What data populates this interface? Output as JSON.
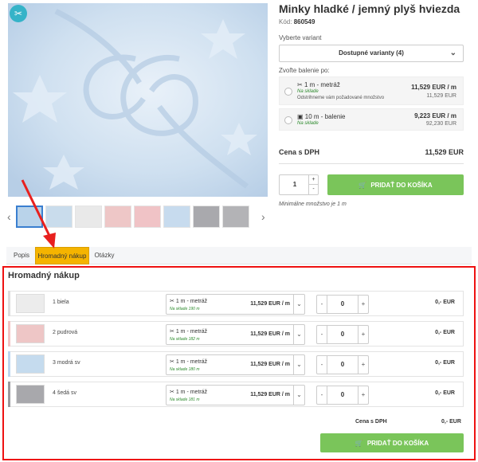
{
  "product": {
    "title": "Minky hladké / jemný plyš hviezda",
    "code_label": "Kód:",
    "code_value": "860549",
    "variant_label": "Vyberte variant",
    "variant_value": "Dostupné varianty (4)",
    "pack_label": "Zvoľte balenie po:",
    "packs": [
      {
        "name": "1 m - metráž",
        "stock": "Na sklade",
        "note": "Odstrihneme vám požadované množstvo",
        "price": "11,529 EUR / m",
        "price2": "11,529 EUR"
      },
      {
        "name": "10 m - balenie",
        "stock": "Na sklade",
        "price": "9,223 EUR / m",
        "price2": "92,230 EUR"
      }
    ],
    "cena_label": "Cena s DPH",
    "cena_value": "11,529 EUR",
    "qty": "1",
    "add_to_cart": "PRIDAŤ DO KOŠÍKA",
    "min_note": "Minimálne množstvo je 1 m"
  },
  "thumbnails": {
    "colors": [
      "#b9d3ea",
      "#c9dcec",
      "#e9e9e9",
      "#eec7c7",
      "#f0c3c6",
      "#c7dbee",
      "#a9a9ad",
      "#b3b3b6",
      "#d07a4a"
    ]
  },
  "tabs": [
    {
      "label": "Popis"
    },
    {
      "label": "Hromadný nákup"
    },
    {
      "label": "Otázky"
    }
  ],
  "bulk": {
    "title": "Hromadný nákup",
    "rows": [
      {
        "name": "1 biela",
        "swatch": "#ececec",
        "bar": "#dddddd",
        "option": "1 m - metráž",
        "stock": "Na sklade 190 m",
        "price": "11,529 EUR / m",
        "qty": "0",
        "total": "0,- EUR"
      },
      {
        "name": "2 pudrová",
        "swatch": "#eec6c6",
        "bar": "#f2c3c3",
        "option": "1 m - metráž",
        "stock": "Na sklade 182 m",
        "price": "11,529 EUR / m",
        "qty": "0",
        "total": "0,- EUR"
      },
      {
        "name": "3 modrá sv",
        "swatch": "#c5dbee",
        "bar": "#bcd5ef",
        "option": "1 m - metráž",
        "stock": "Na sklade 180 m",
        "price": "11,529 EUR / m",
        "qty": "0",
        "total": "0,- EUR"
      },
      {
        "name": "4 šedá sv",
        "swatch": "#a8a8ac",
        "bar": "#9a9a9e",
        "option": "1 m - metráž",
        "stock": "Na sklade 181 m",
        "price": "11,529 EUR / m",
        "qty": "0",
        "total": "0,- EUR"
      }
    ],
    "cena_label": "Cena s DPH",
    "cena_value": "0,- EUR",
    "add_to_cart": "PRIDAŤ DO KOŠÍKA"
  },
  "colors": {
    "accent_green": "#7ac55a",
    "tab_active": "#f5b400",
    "highlight_red": "#e11111",
    "arrow_red": "#e8201e"
  }
}
